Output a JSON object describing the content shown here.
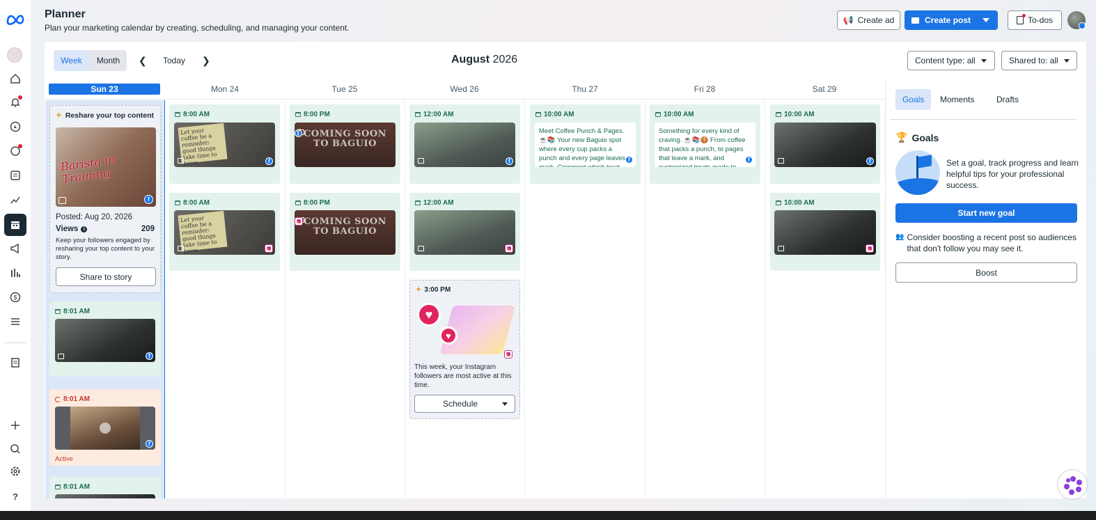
{
  "header": {
    "title": "Planner",
    "subtitle": "Plan your marketing calendar by creating, scheduling, and managing your content.",
    "create_ad": "Create ad",
    "create_post": "Create post",
    "todos": "To-dos"
  },
  "toolbar": {
    "week": "Week",
    "month": "Month",
    "today": "Today",
    "month_name": "August",
    "year": "2026",
    "content_type": "Content type: all",
    "shared_to": "Shared to: all"
  },
  "days": [
    "Sun 23",
    "Mon 24",
    "Tue 25",
    "Wed 26",
    "Thu 27",
    "Fri 28",
    "Sat 29"
  ],
  "sunday": {
    "reshare_title": "Reshare your top content",
    "thumb_text": "Barista in Training",
    "posted": "Posted: Aug 20, 2026",
    "views_label": "Views",
    "views_value": "209",
    "reshare_desc": "Keep your followers engaged by resharing your top content to your story.",
    "share_button": "Share to story",
    "post1_time": "8:01 AM",
    "post2_time": "8:01 AM",
    "post2_status": "Active",
    "post3_time": "8:01 AM"
  },
  "posts": {
    "mon_fb_time": "8:00 AM",
    "mon_ig_time": "8:00 AM",
    "note_text": "Let your coffee be a reminder: good things take time to brew",
    "tue_fb_time": "8:00 PM",
    "tue_ig_time": "8:00 PM",
    "coming_text": "COMING SOON TO BAGUIO",
    "wed_fb_time": "12:00 AM",
    "wed_ig_time": "12:00 AM",
    "wed_suggest_time": "3:00 PM",
    "wed_suggest_text": "This week, your Instagram followers are most active at this time.",
    "schedule_label": "Schedule",
    "thu_time": "10:00 AM",
    "thu_text": "Meet Coffee Punch & Pages. ☕📚 Your new Baguio spot where every cup packs a punch and every page leaves a mark. Comment which treat you'd try",
    "fri_time": "10:00 AM",
    "fri_text": "Something for every kind of craving. ☕📚🍪 From coffee that packs a punch, to pages that leave a mark, and customized treats made to",
    "sat_fb_time": "10:00 AM",
    "sat_ig_time": "10:00 AM"
  },
  "right_panel": {
    "tabs": [
      "Goals",
      "Moments",
      "Drafts"
    ],
    "goals_title": "Goals",
    "goals_desc": "Set a goal, track progress and learn helpful tips for your professional success.",
    "start_goal": "Start new goal",
    "boost_desc": "Consider boosting a recent post so audiences that don't follow you may see it.",
    "boost_button": "Boost"
  },
  "colors": {
    "accent": "#1b74e4",
    "post_bg": "#e3f2ec",
    "active_bg": "#fdebe0"
  },
  "icons": [
    "meta-logo",
    "home-icon",
    "bell-icon",
    "compass-icon",
    "chat-icon",
    "content-icon",
    "insights-icon",
    "calendar-icon",
    "megaphone-icon",
    "chart-icon",
    "dollar-icon",
    "menu-icon",
    "pages-icon",
    "plus-icon",
    "search-icon",
    "settings-icon",
    "help-icon"
  ]
}
